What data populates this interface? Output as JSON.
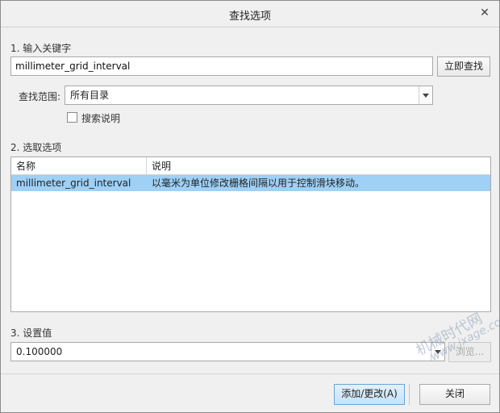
{
  "dialog": {
    "title": "查找选项"
  },
  "step1": {
    "label": "1.  输入关键字",
    "keyword_value": "millimeter_grid_interval",
    "find_now_button": "立即查找",
    "scope_label": "查找范围:",
    "scope_value": "所有目录",
    "search_desc_label": "搜索说明"
  },
  "step2": {
    "label": "2.  选取选项",
    "columns": [
      "名称",
      "说明"
    ],
    "rows": [
      [
        "millimeter_grid_interval",
        "以毫米为单位修改栅格间隔以用于控制滑块移动。"
      ]
    ]
  },
  "step3": {
    "label": "3.  设置值",
    "value": "0.100000",
    "browse_button": "浏览..."
  },
  "footer": {
    "add_change_button": "添加/更改(A)",
    "close_button": "关闭"
  },
  "watermark": {
    "line1": "机械时代网",
    "line2": "www.jxage.com"
  }
}
